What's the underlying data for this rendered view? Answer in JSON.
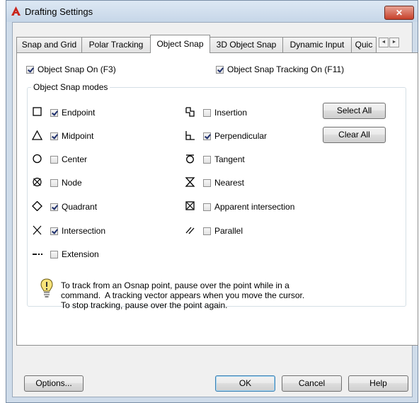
{
  "window": {
    "title": "Drafting Settings",
    "close_label": "✕"
  },
  "tabs": [
    {
      "label": "Snap and Grid",
      "active": false
    },
    {
      "label": "Polar Tracking",
      "active": false
    },
    {
      "label": "Object Snap",
      "active": true
    },
    {
      "label": "3D Object Snap",
      "active": false
    },
    {
      "label": "Dynamic Input",
      "active": false
    },
    {
      "label": "Quic",
      "active": false
    }
  ],
  "tab_scroll": {
    "left": "◄",
    "right": "►"
  },
  "options": {
    "osnap_on": {
      "label": "Object Snap On (F3)",
      "checked": true
    },
    "tracking_on": {
      "label": "Object Snap Tracking On (F11)",
      "checked": true
    }
  },
  "group": {
    "label": "Object Snap modes",
    "left_modes": [
      {
        "label": "Endpoint",
        "checked": true,
        "icon": "endpoint-square-icon"
      },
      {
        "label": "Midpoint",
        "checked": true,
        "icon": "midpoint-triangle-icon"
      },
      {
        "label": "Center",
        "checked": false,
        "icon": "center-circle-icon"
      },
      {
        "label": "Node",
        "checked": false,
        "icon": "node-icon"
      },
      {
        "label": "Quadrant",
        "checked": true,
        "icon": "quadrant-diamond-icon"
      },
      {
        "label": "Intersection",
        "checked": true,
        "icon": "intersection-x-icon"
      },
      {
        "label": "Extension",
        "checked": false,
        "icon": "extension-dash-icon"
      }
    ],
    "right_modes": [
      {
        "label": "Insertion",
        "checked": false,
        "icon": "insertion-icon"
      },
      {
        "label": "Perpendicular",
        "checked": true,
        "icon": "perpendicular-icon"
      },
      {
        "label": "Tangent",
        "checked": false,
        "icon": "tangent-icon"
      },
      {
        "label": "Nearest",
        "checked": false,
        "icon": "nearest-hourglass-icon"
      },
      {
        "label": "Apparent intersection",
        "checked": false,
        "icon": "apparent-intersection-icon"
      },
      {
        "label": "Parallel",
        "checked": false,
        "icon": "parallel-icon"
      }
    ],
    "select_all_label": "Select All",
    "clear_all_label": "Clear All"
  },
  "info": {
    "text": "To track from an Osnap point, pause over the point while in a\ncommand.  A tracking vector appears when you move the cursor.\nTo stop tracking, pause over the point again."
  },
  "footer": {
    "options_label": "Options...",
    "ok_label": "OK",
    "cancel_label": "Cancel",
    "help_label": "Help"
  },
  "colors": {
    "frame": "#cfdcea",
    "close_button": "#c7402a",
    "check_mark": "#1e2f6d",
    "ok_border": "#3c7fb1"
  }
}
